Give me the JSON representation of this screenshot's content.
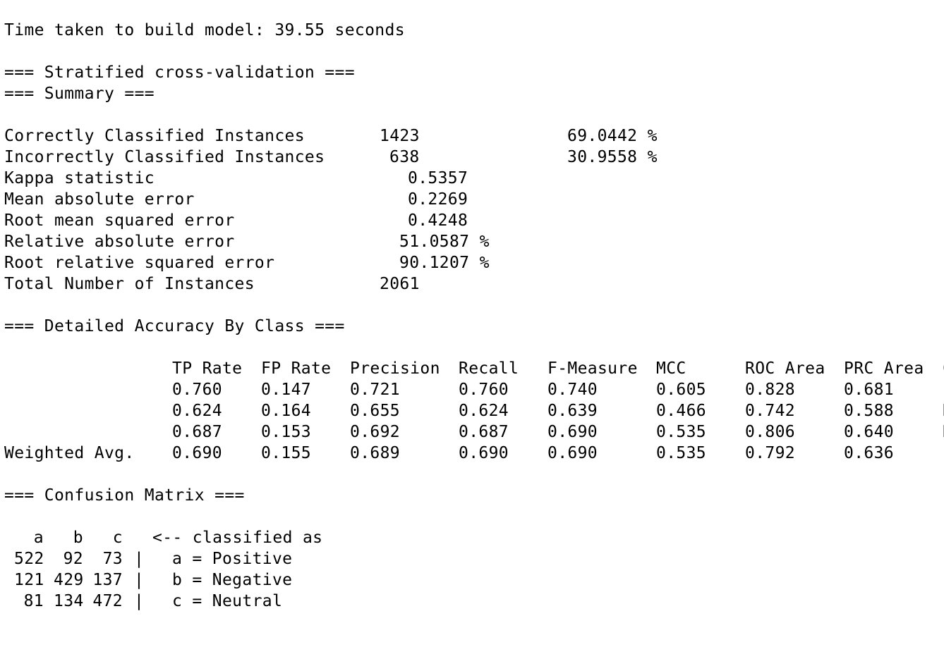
{
  "time_line": "Time taken to build model: 39.55 seconds",
  "cv_header": "=== Stratified cross-validation ===",
  "summary_header": "=== Summary ===",
  "summary": [
    {
      "label": "Correctly Classified Instances",
      "value": "1423",
      "pct": "69.0442 %"
    },
    {
      "label": "Incorrectly Classified Instances",
      "value": "638",
      "pct": "30.9558 %"
    },
    {
      "label": "Kappa statistic",
      "value": "0.5357"
    },
    {
      "label": "Mean absolute error",
      "value": "0.2269"
    },
    {
      "label": "Root mean squared error",
      "value": "0.4248"
    },
    {
      "label": "Relative absolute error",
      "value": "51.0587 %"
    },
    {
      "label": "Root relative squared error",
      "value": "90.1207 %"
    },
    {
      "label": "Total Number of Instances",
      "value": "2061"
    }
  ],
  "detail_header": "=== Detailed Accuracy By Class ===",
  "detail_columns": [
    "TP Rate",
    "FP Rate",
    "Precision",
    "Recall",
    "F-Measure",
    "MCC",
    "ROC Area",
    "PRC Area",
    "C"
  ],
  "detail_rows": [
    {
      "label": "",
      "values": [
        "0.760",
        "0.147",
        "0.721",
        "0.760",
        "0.740",
        "0.605",
        "0.828",
        "0.681",
        "P"
      ]
    },
    {
      "label": "",
      "values": [
        "0.624",
        "0.164",
        "0.655",
        "0.624",
        "0.639",
        "0.466",
        "0.742",
        "0.588",
        "N"
      ]
    },
    {
      "label": "",
      "values": [
        "0.687",
        "0.153",
        "0.692",
        "0.687",
        "0.690",
        "0.535",
        "0.806",
        "0.640",
        "N"
      ]
    },
    {
      "label": "Weighted Avg.",
      "values": [
        "0.690",
        "0.155",
        "0.689",
        "0.690",
        "0.690",
        "0.535",
        "0.792",
        "0.636",
        ""
      ]
    }
  ],
  "confusion_header": "=== Confusion Matrix ===",
  "confusion_cols": [
    "a",
    "b",
    "c"
  ],
  "confusion_note": "<-- classified as",
  "confusion_rows": [
    {
      "a": "522",
      "b": "92",
      "c": "73",
      "label": "a = Positive"
    },
    {
      "a": "121",
      "b": "429",
      "c": "137",
      "label": "b = Negative"
    },
    {
      "a": "81",
      "b": "134",
      "c": "472",
      "label": "c = Neutral"
    }
  ],
  "confusion_sep": "|"
}
